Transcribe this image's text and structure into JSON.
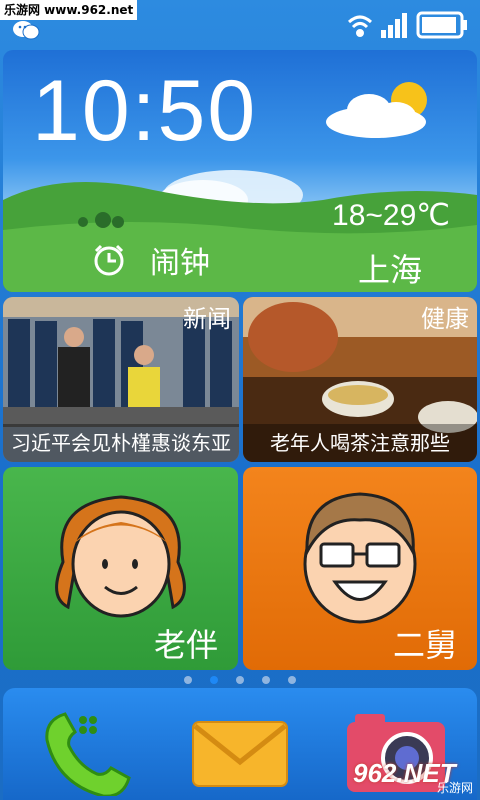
{
  "statusbar": {
    "watermark": "乐游网 www.962.net",
    "battery_level": 0.95
  },
  "weather": {
    "time": "10:50",
    "temperature": "18~29℃",
    "city": "上海",
    "alarm_label": "闹钟"
  },
  "news": {
    "tag": "新闻",
    "headline": "习近平会见朴槿惠谈东亚"
  },
  "health": {
    "tag": "健康",
    "headline": "老年人喝茶注意那些"
  },
  "contacts": [
    {
      "name": "老伴"
    },
    {
      "name": "二舅"
    }
  ],
  "pager": {
    "pages": 5,
    "active": 1
  },
  "dock": {
    "logo": "962.NET",
    "logo_sub": "乐游网"
  }
}
